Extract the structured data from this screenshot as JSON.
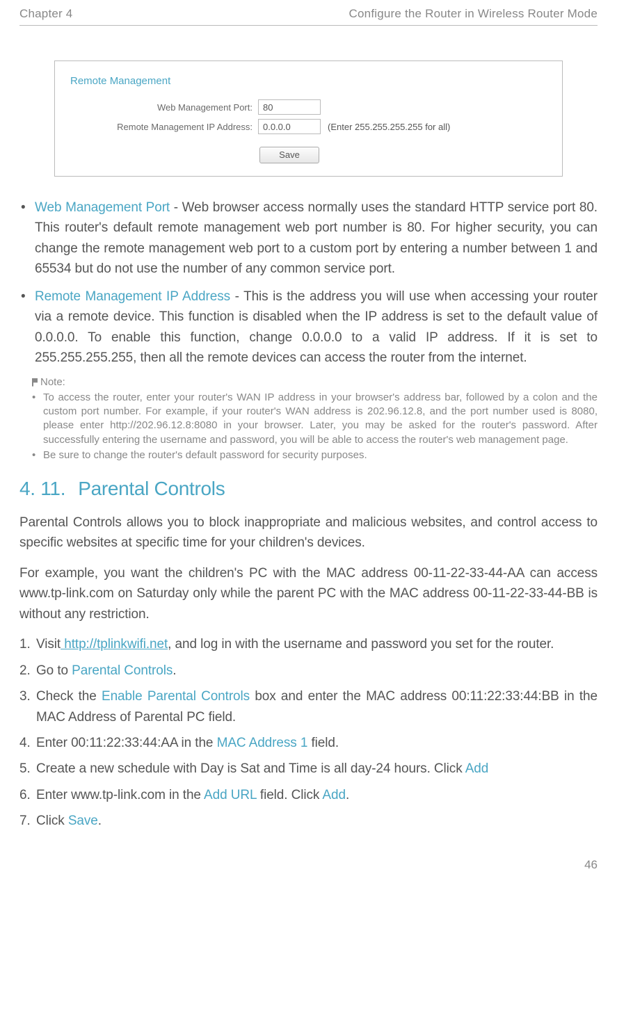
{
  "header": {
    "chapter": "Chapter 4",
    "title": "Configure the Router in Wireless Router Mode"
  },
  "screenshot": {
    "panel_title": "Remote Management",
    "row1_label": "Web Management Port:",
    "row1_value": "80",
    "row2_label": "Remote Management IP Address:",
    "row2_value": "0.0.0.0",
    "row2_hint": "(Enter 255.255.255.255 for all)",
    "save_label": "Save"
  },
  "bullets": {
    "b1_term": "Web Management Port",
    "b1_text": " - Web browser access normally uses the standard HTTP service port 80. This router's default remote management web port number is 80. For higher security, you can change the remote management web port to a custom port by entering a number between 1 and 65534 but do not use the number of any common service port.",
    "b2_term": "Remote Management IP Address",
    "b2_text": " - This is the address you will use when accessing your router via a remote device. This function is disabled when the IP address is set to the default value of 0.0.0.0. To enable this function, change 0.0.0.0 to a valid IP address. If it is set to 255.255.255.255, then all the remote devices can access the router from the internet."
  },
  "note": {
    "title": "Note:",
    "n1": "To access the router, enter your router's WAN IP address in your browser's address bar, followed by a colon and the custom port number. For example, if your router's WAN address is 202.96.12.8, and the port number used is 8080, please enter http://202.96.12.8:8080 in your browser. Later, you may be asked for the router's password. After successfully entering the username and password, you will be able to access the router's web management page.",
    "n2": "Be sure to change the router's default password for security purposes."
  },
  "section": {
    "number": "4. 11.",
    "title": "Parental Controls",
    "intro_p": "Parental Controls allows you to block inappropriate and malicious websites, and control access to specific websites at specific time for your children's devices.",
    "example_p": "For example, you want the children's PC with the MAC address 00-11-22-33-44-AA can access www.tp-link.com on Saturday only while the parent PC with the MAC address 00-11-22-33-44-BB is without any restriction."
  },
  "steps": {
    "s1_pre": "Visit",
    "s1_link": " http://tplinkwifi.net",
    "s1_post": ", and log in with the username and password you set for the router.",
    "s2_pre": "Go to ",
    "s2_term": "Parental Controls",
    "s2_post": ".",
    "s3_pre": "Check the ",
    "s3_term": "Enable Parental Controls",
    "s3_post": " box and enter the MAC address 00:11:22:33:44:BB in the MAC Address of Parental PC field.",
    "s4_pre": "Enter 00:11:22:33:44:AA in the ",
    "s4_term": "MAC Address 1",
    "s4_post": " field.",
    "s5_pre": "Create a new schedule with Day is Sat and Time is all day-24 hours. Click ",
    "s5_term": "Add",
    "s6_pre": "Enter www.tp-link.com in the ",
    "s6_term1": "Add URL",
    "s6_mid": " field. Click ",
    "s6_term2": "Add",
    "s6_post": ".",
    "s7_pre": "Click ",
    "s7_term": "Save",
    "s7_post": "."
  },
  "page_number": "46"
}
